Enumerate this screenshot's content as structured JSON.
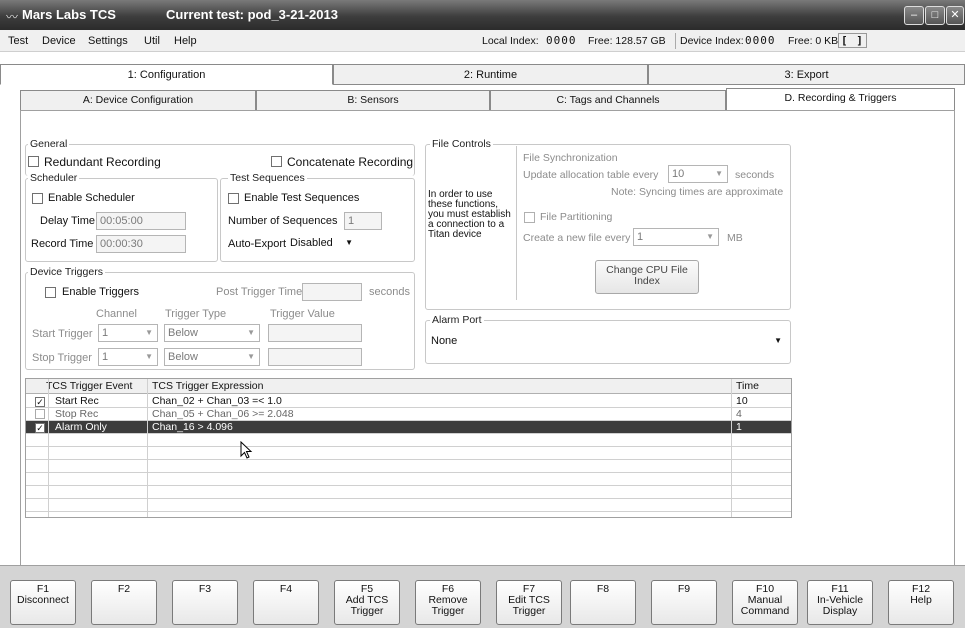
{
  "window": {
    "app_title": "Mars Labs TCS",
    "test_title": "Current test: pod_3-21-2013",
    "minimize_glyph": "–",
    "maximize_glyph": "□",
    "close_glyph": "✕"
  },
  "menu": {
    "items": [
      "Test",
      "Device",
      "Settings",
      "Util",
      "Help"
    ],
    "local_index_label": "Local Index:",
    "local_index_value": "0000",
    "local_free": "Free: 128.57 GB",
    "device_index_label": "Device Index:",
    "device_index_value": "0000",
    "device_free": "Free: 0 KB",
    "device_bracket": "[ ]"
  },
  "tabs": [
    "1: Configuration",
    "2: Runtime",
    "3: Export"
  ],
  "subtabs": [
    "A: Device Configuration",
    "B: Sensors",
    "C: Tags and Channels",
    "D. Recording & Triggers"
  ],
  "general": {
    "title": "General",
    "redundant_label": "Redundant Recording",
    "concatenate_label": "Concatenate Recording"
  },
  "scheduler": {
    "title": "Scheduler",
    "enable_label": "Enable Scheduler",
    "delay_label": "Delay Time",
    "delay_value": "00:05:00",
    "record_label": "Record Time",
    "record_value": "00:00:30"
  },
  "test_sequences": {
    "title": "Test Sequences",
    "enable_label": "Enable Test Sequences",
    "number_label": "Number of Sequences",
    "number_value": "1",
    "autoexport_label": "Auto-Export",
    "autoexport_value": "Disabled"
  },
  "device_triggers": {
    "title": "Device Triggers",
    "enable_label": "Enable Triggers",
    "post_trigger_label": "Post Trigger Time",
    "post_trigger_value": "",
    "seconds_label": "seconds",
    "channel_header": "Channel",
    "type_header": "Trigger Type",
    "value_header": "Trigger Value",
    "start_label": "Start Trigger",
    "start_channel": "1",
    "start_type": "Below",
    "start_value": "",
    "stop_label": "Stop Trigger",
    "stop_channel": "1",
    "stop_type": "Below",
    "stop_value": ""
  },
  "file_controls": {
    "title": "File Controls",
    "notice": "In order to use these functions, you must establish a connection to a Titan device",
    "sync_title": "File Synchronization",
    "update_label": "Update allocation table every",
    "update_value": "10",
    "update_units": "seconds",
    "sync_note": "Note: Syncing times are approximate",
    "partition_label": "File Partitioning",
    "create_label": "Create a new file every",
    "create_value": "1",
    "create_units": "MB",
    "change_cpu_button": "Change CPU File Index"
  },
  "alarm_port": {
    "title": "Alarm Port",
    "value": "None"
  },
  "trigger_table": {
    "headers": [
      "TCS Trigger Event",
      "TCS Trigger Expression",
      "Time"
    ],
    "rows": [
      {
        "checked": true,
        "event": "Start Rec",
        "expression": "Chan_02 + Chan_03 =< 1.0",
        "time": "10"
      },
      {
        "checked": false,
        "event": "Stop Rec",
        "expression": "Chan_05 + Chan_06 >= 2.048",
        "time": "4"
      },
      {
        "checked": true,
        "event": "Alarm Only",
        "expression": "Chan_16 > 4.096",
        "time": "1"
      }
    ]
  },
  "function_keys": [
    {
      "key": "F1",
      "label": "Disconnect"
    },
    {
      "key": "F2",
      "label": ""
    },
    {
      "key": "F3",
      "label": ""
    },
    {
      "key": "F4",
      "label": ""
    },
    {
      "key": "F5",
      "label": "Add TCS\nTrigger"
    },
    {
      "key": "F6",
      "label": "Remove\nTrigger"
    },
    {
      "key": "F7",
      "label": "Edit TCS\nTrigger"
    },
    {
      "key": "F8",
      "label": ""
    },
    {
      "key": "F9",
      "label": ""
    },
    {
      "key": "F10",
      "label": "Manual\nCommand"
    },
    {
      "key": "F11",
      "label": "In-Vehicle\nDisplay"
    },
    {
      "key": "F12",
      "label": "Help"
    }
  ]
}
